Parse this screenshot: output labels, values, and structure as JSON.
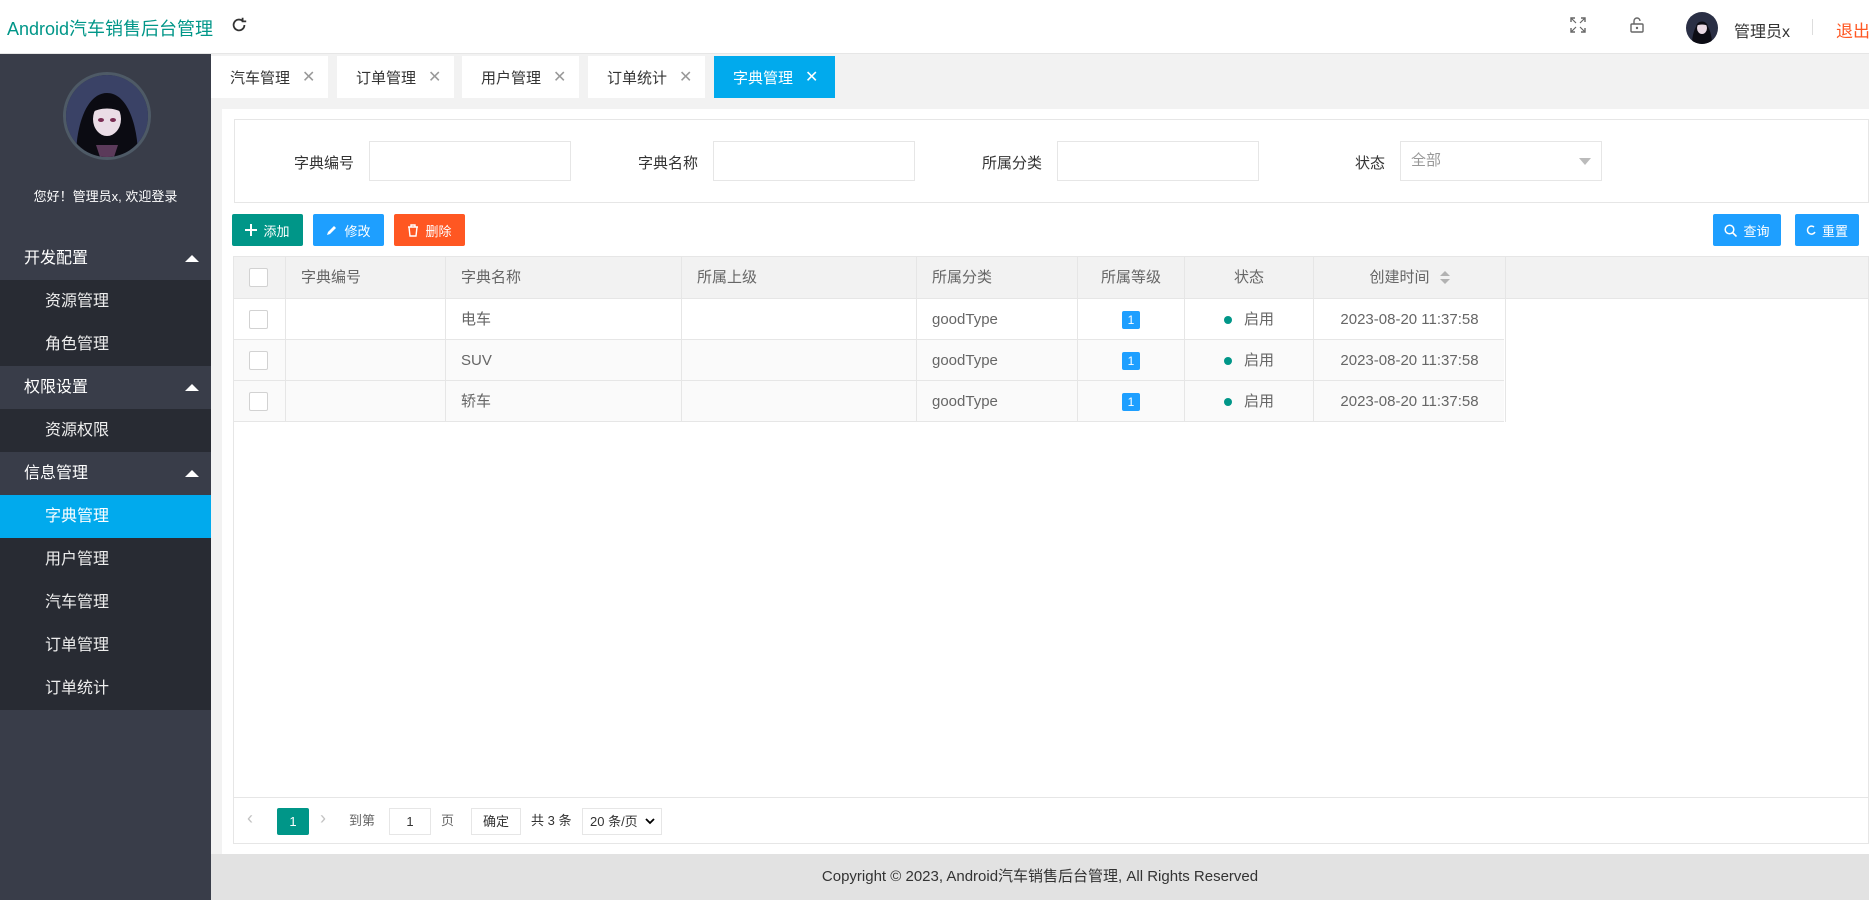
{
  "header": {
    "title": "Android汽车销售后台管理",
    "username": "管理员x",
    "logout_label": "退出"
  },
  "sidebar": {
    "welcome": "您好！管理员x, 欢迎登录",
    "groups": [
      {
        "label": "开发配置",
        "items": [
          "资源管理",
          "角色管理"
        ]
      },
      {
        "label": "权限设置",
        "items": [
          "资源权限"
        ]
      },
      {
        "label": "信息管理",
        "items": [
          "字典管理",
          "用户管理",
          "汽车管理",
          "订单管理",
          "订单统计"
        ]
      }
    ],
    "active_item": "字典管理"
  },
  "tabs": [
    {
      "label": "汽车管理"
    },
    {
      "label": "订单管理"
    },
    {
      "label": "用户管理"
    },
    {
      "label": "订单统计"
    },
    {
      "label": "字典管理",
      "active": true
    }
  ],
  "filter": {
    "code_label": "字典编号",
    "name_label": "字典名称",
    "category_label": "所属分类",
    "status_label": "状态",
    "status_value": "全部"
  },
  "actions": {
    "add": "添加",
    "edit": "修改",
    "delete": "删除",
    "search": "查询",
    "reset": "重置"
  },
  "table": {
    "columns": [
      "字典编号",
      "字典名称",
      "所属上级",
      "所属分类",
      "所属等级",
      "状态",
      "创建时间"
    ],
    "rows": [
      {
        "code": "",
        "name": "电车",
        "parent": "",
        "category": "goodType",
        "level": "1",
        "status": "启用",
        "created": "2023-08-20 11:37:58"
      },
      {
        "code": "",
        "name": "SUV",
        "parent": "",
        "category": "goodType",
        "level": "1",
        "status": "启用",
        "created": "2023-08-20 11:37:58"
      },
      {
        "code": "",
        "name": "轿车",
        "parent": "",
        "category": "goodType",
        "level": "1",
        "status": "启用",
        "created": "2023-08-20 11:37:58"
      }
    ]
  },
  "pagination": {
    "current": "1",
    "goto_label": "到第",
    "goto_value": "1",
    "page_unit": "页",
    "confirm": "确定",
    "total": "共 3 条",
    "page_size": "20 条/页"
  },
  "footer": "Copyright © 2023, Android汽车销售后台管理, All Rights Reserved",
  "colors": {
    "primary": "#009688",
    "accent": "#01aaed",
    "danger": "#ff5722",
    "sidebar": "#393d49"
  }
}
